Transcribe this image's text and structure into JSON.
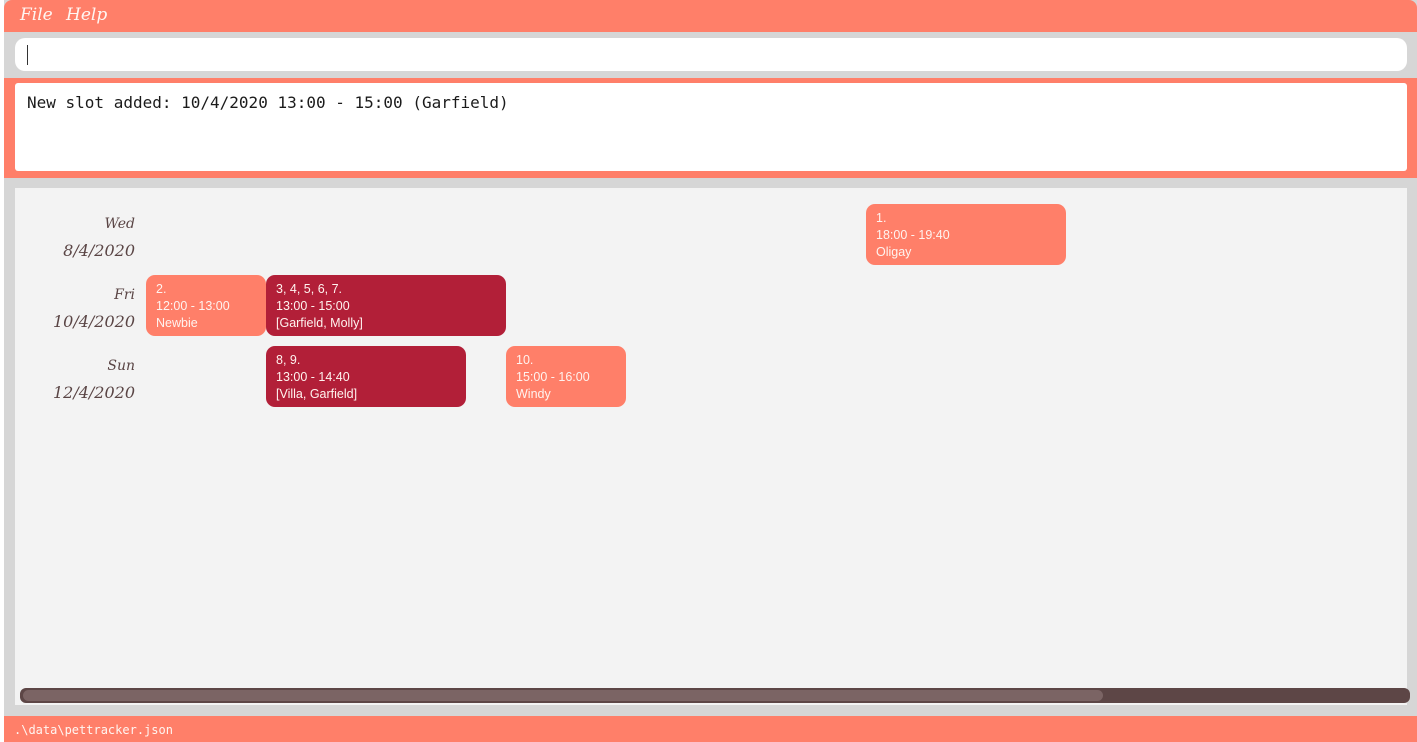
{
  "menu": {
    "file_label": "File",
    "help_label": "Help"
  },
  "command": {
    "value": "",
    "placeholder": ""
  },
  "result": {
    "message": "New slot added: 10/4/2020 13:00 - 15:00 (Garfield)"
  },
  "calendar": {
    "days": [
      {
        "name": "Wed",
        "date": "8/4/2020"
      },
      {
        "name": "Fri",
        "date": "10/4/2020"
      },
      {
        "name": "Sun",
        "date": "12/4/2020"
      }
    ],
    "slots": [
      {
        "index": "1.",
        "time": "18:00 - 19:40",
        "pets": "Oligay",
        "status": "normal"
      },
      {
        "index": "2.",
        "time": "12:00 - 13:00",
        "pets": "Newbie",
        "status": "normal"
      },
      {
        "index": "3, 4, 5, 6, 7.",
        "time": "13:00 - 15:00",
        "pets": "[Garfield, Molly]",
        "status": "conflict"
      },
      {
        "index": "8, 9.",
        "time": "13:00 - 14:40",
        "pets": "[Villa, Garfield]",
        "status": "conflict"
      },
      {
        "index": "10.",
        "time": "15:00 - 16:00",
        "pets": "Windy",
        "status": "normal"
      }
    ]
  },
  "scrollbar": {
    "thumb_fraction": 0.78
  },
  "status": {
    "file_path": ".\\data\\pettracker.json"
  },
  "colors": {
    "accent": "#ff7f69",
    "conflict": "#b21f38",
    "panel_background": "#f3f3f3",
    "scrollbar_track": "#5d4646"
  }
}
